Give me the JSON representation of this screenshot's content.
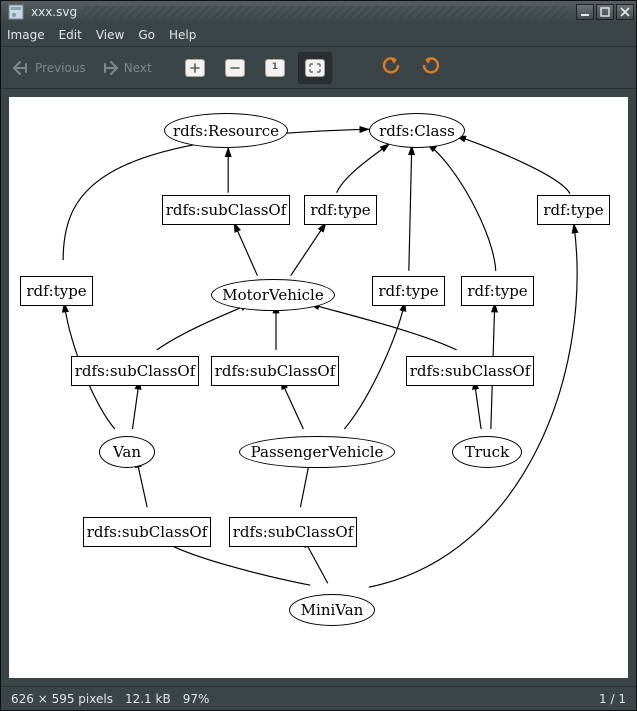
{
  "window": {
    "title": "xxx.svg"
  },
  "menubar": {
    "items": [
      "Image",
      "Edit",
      "View",
      "Go",
      "Help"
    ]
  },
  "toolbar": {
    "prev_label": "Previous",
    "next_label": "Next"
  },
  "statusbar": {
    "dims": "626 × 595 pixels",
    "size": "12.1 kB",
    "zoom": "97%",
    "page": "1 / 1"
  },
  "diagram": {
    "nodes": {
      "resource": {
        "label": "rdfs:Resource"
      },
      "class": {
        "label": "rdfs:Class"
      },
      "mv": {
        "label": "MotorVehicle"
      },
      "van": {
        "label": "Van"
      },
      "pv": {
        "label": "PassengerVehicle"
      },
      "truck": {
        "label": "Truck"
      },
      "minivan": {
        "label": "MiniVan"
      },
      "sco_mv": {
        "label": "rdfs:subClassOf"
      },
      "type_mv": {
        "label": "rdf:type"
      },
      "type_left": {
        "label": "rdf:type"
      },
      "type_mid": {
        "label": "rdf:type"
      },
      "type_right": {
        "label": "rdf:type"
      },
      "type_far": {
        "label": "rdf:type"
      },
      "sco_van": {
        "label": "rdfs:subClassOf"
      },
      "sco_pv": {
        "label": "rdfs:subClassOf"
      },
      "sco_truck": {
        "label": "rdfs:subClassOf"
      },
      "sco_mv_van": {
        "label": "rdfs:subClassOf"
      },
      "sco_mv_pv": {
        "label": "rdfs:subClassOf"
      }
    }
  }
}
